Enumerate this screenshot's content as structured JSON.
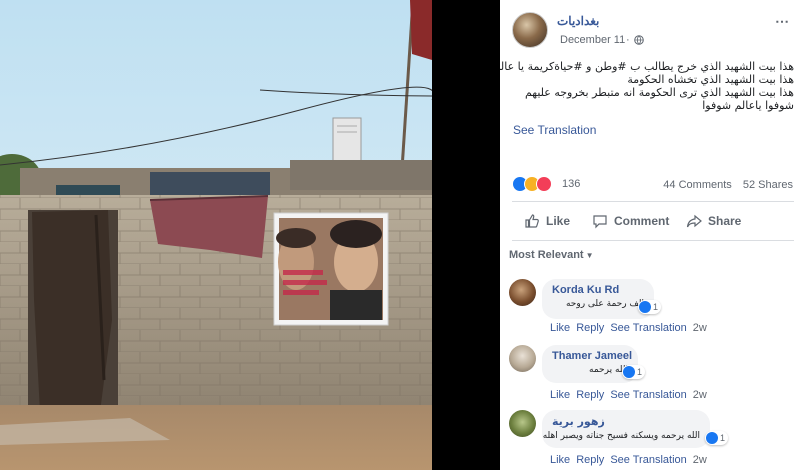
{
  "post": {
    "author": "بغداديات",
    "date": "December 11",
    "dot": "·",
    "text_lines": [
      "هذا بيت الشهيد الذي خرج يطالب ب #وطن و #حياةكريمة يا عالم",
      "هذا بيت الشهيد الذي تخشاه الحكومة",
      "هذا بيت الشهيد الذي ترى الحكومة انه متبطر بخروجه عليهم",
      "شوفوا ياعالم شوفوا"
    ],
    "see_translation": "See Translation",
    "reaction_count": "136",
    "comments_count": "44 Comments",
    "shares_count": "52 Shares",
    "more_icon": "⋯"
  },
  "actions": {
    "like": "Like",
    "comment": "Comment",
    "share": "Share"
  },
  "sort": {
    "label": "Most Relevant",
    "caret": "▼"
  },
  "comments": [
    {
      "name": "Korda Ku Rd",
      "text": "الف رحمة على روحه",
      "reactions": "1",
      "like": "Like",
      "reply": "Reply",
      "translate": "See Translation",
      "time": "2w"
    },
    {
      "name": "Thamer Jameel",
      "text": "الله يرحمه",
      "reactions": "1",
      "like": "Like",
      "reply": "Reply",
      "translate": "See Translation",
      "time": "2w"
    },
    {
      "name": "زهور برية",
      "text": "الله يرحمه ويسكنه فسيح جناته ويصبر اهله",
      "reactions": "1",
      "like": "Like",
      "reply": "Reply",
      "translate": "See Translation",
      "time": "2w"
    }
  ],
  "colors": {
    "link": "#385898",
    "meta": "#606770",
    "like_blue": "#1877f2",
    "love_red": "#f33e58",
    "sad_yellow": "#f7b125",
    "bubble": "#f2f3f5"
  }
}
